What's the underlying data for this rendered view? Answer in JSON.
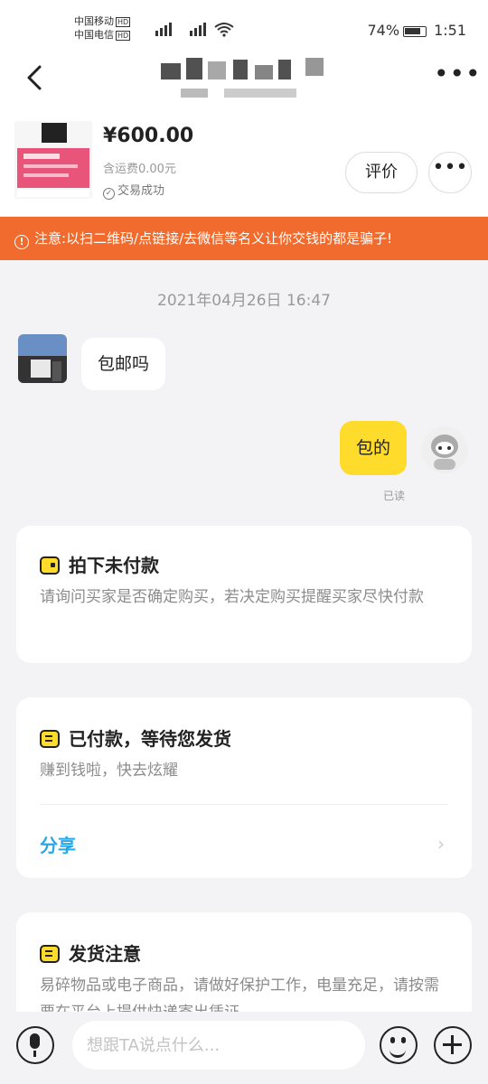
{
  "status_bar": {
    "carrier1": "中国移动",
    "carrier2": "中国电信",
    "hd": "HD",
    "battery": "74%",
    "time": "1:51"
  },
  "product": {
    "price": "¥600.00",
    "freight": "含运费0.00元",
    "status": "交易成功",
    "rate_label": "评价",
    "more_label": "•••"
  },
  "warning": {
    "text": "注意:以扫二维码/点链接/去微信等名义让你交钱的都是骗子!"
  },
  "chat": {
    "timestamp": "2021年04月26日 16:47",
    "messages": [
      {
        "side": "left",
        "text": "包邮吗"
      },
      {
        "side": "right",
        "text": "包的"
      }
    ],
    "read_label": "已读"
  },
  "cards": [
    {
      "title": "拍下未付款",
      "desc": "请询问买家是否确定购买，若决定购买提醒买家尽快付款"
    },
    {
      "title": "已付款，等待您发货",
      "desc": "赚到钱啦，快去炫耀",
      "action": "分享"
    },
    {
      "title": "发货注意",
      "desc": "易碎物品或电子商品，请做好保护工作，电量充足，请按需要在平台上提供快递寄出凭证"
    }
  ],
  "input": {
    "placeholder": "想跟TA说点什么..."
  },
  "colors": {
    "warning_bg": "#f06b2d",
    "accent_yellow": "#ffdb2b",
    "link_blue": "#27a7e7"
  }
}
